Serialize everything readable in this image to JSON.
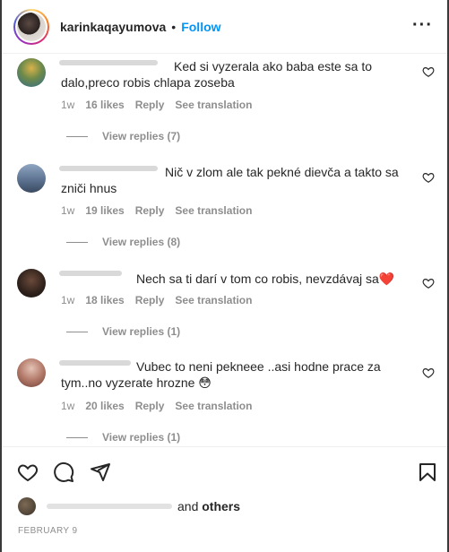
{
  "header": {
    "username": "karinkaqayumova",
    "separator": "•",
    "follow_label": "Follow",
    "more_icon": "more-horizontal-icon"
  },
  "comments": [
    {
      "text": "Ked si vyzerala ako baba este sa to dalo,preco robis chlapa zoseba",
      "time": "1w",
      "likes": "16 likes",
      "reply_label": "Reply",
      "translate_label": "See translation",
      "view_replies": "View replies (7)"
    },
    {
      "text": "Nič v zlom ale tak pekné dievča a takto sa zniči hnus",
      "time": "1w",
      "likes": "19 likes",
      "reply_label": "Reply",
      "translate_label": "See translation",
      "view_replies": "View replies (8)"
    },
    {
      "text": "Nech sa ti darí v tom co robis, nevzdávaj sa",
      "emoji": "❤️",
      "time": "1w",
      "likes": "18 likes",
      "reply_label": "Reply",
      "translate_label": "See translation",
      "view_replies": "View replies (1)"
    },
    {
      "text": "Vubec to neni pekneee ..asi hodne prace za tym..no vyzerate hrozne",
      "emoji": "😳",
      "time": "1w",
      "likes": "20 likes",
      "reply_label": "Reply",
      "translate_label": "See translation",
      "view_replies": "View replies (1)"
    }
  ],
  "actions": {
    "like_icon": "heart-icon",
    "comment_icon": "comment-icon",
    "share_icon": "share-icon",
    "save_icon": "bookmark-icon"
  },
  "likes_summary": {
    "conjunction": "and",
    "others": "others"
  },
  "post_date": "FEBRUARY 9",
  "colors": {
    "link": "#0095f6",
    "muted": "#8e8e8e",
    "text": "#262626"
  }
}
